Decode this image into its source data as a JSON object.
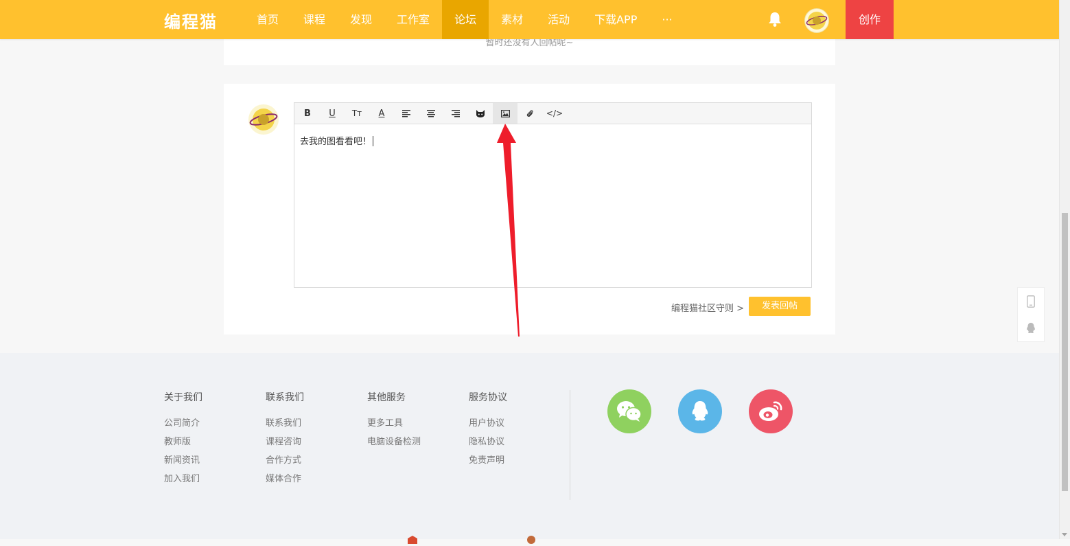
{
  "header": {
    "logo": "编程猫",
    "nav": [
      "首页",
      "课程",
      "发现",
      "工作室",
      "论坛",
      "素材",
      "活动",
      "下载APP",
      "···"
    ],
    "active_index": 4,
    "create_label": "创作",
    "brand_color": "#ffc12e",
    "create_color": "#ee4343"
  },
  "thread": {
    "empty_hint": "暂时还没有人回帖呢~"
  },
  "editor": {
    "toolbar": [
      {
        "name": "bold-icon",
        "glyph": "B"
      },
      {
        "name": "underline-icon",
        "glyph": "U"
      },
      {
        "name": "font-size-icon",
        "glyph": "Tт"
      },
      {
        "name": "font-color-icon",
        "glyph": "A"
      },
      {
        "name": "align-left-icon",
        "glyph": ""
      },
      {
        "name": "align-center-icon",
        "glyph": ""
      },
      {
        "name": "align-right-icon",
        "glyph": ""
      },
      {
        "name": "emoji-cat-icon",
        "glyph": ""
      },
      {
        "name": "image-icon",
        "glyph": ""
      },
      {
        "name": "attachment-icon",
        "glyph": ""
      },
      {
        "name": "code-icon",
        "glyph": "</>"
      }
    ],
    "active_tool": "image-icon",
    "content": "去我的图看看吧！",
    "rules_link": "编程猫社区守则 >",
    "submit_label": "发表回帖"
  },
  "footer": {
    "columns": [
      {
        "title": "关于我们",
        "links": [
          "公司简介",
          "教师版",
          "新闻资讯",
          "加入我们"
        ]
      },
      {
        "title": "联系我们",
        "links": [
          "联系我们",
          "课程咨询",
          "合作方式",
          "媒体合作"
        ]
      },
      {
        "title": "其他服务",
        "links": [
          "更多工具",
          "电脑设备检测"
        ]
      },
      {
        "title": "服务协议",
        "links": [
          "用户协议",
          "隐私协议",
          "免责声明"
        ]
      }
    ],
    "social": [
      {
        "name": "wechat-icon",
        "color": "#8fd15f"
      },
      {
        "name": "qq-icon",
        "color": "#5bb6e8"
      },
      {
        "name": "weibo-icon",
        "color": "#ee5567"
      }
    ]
  }
}
